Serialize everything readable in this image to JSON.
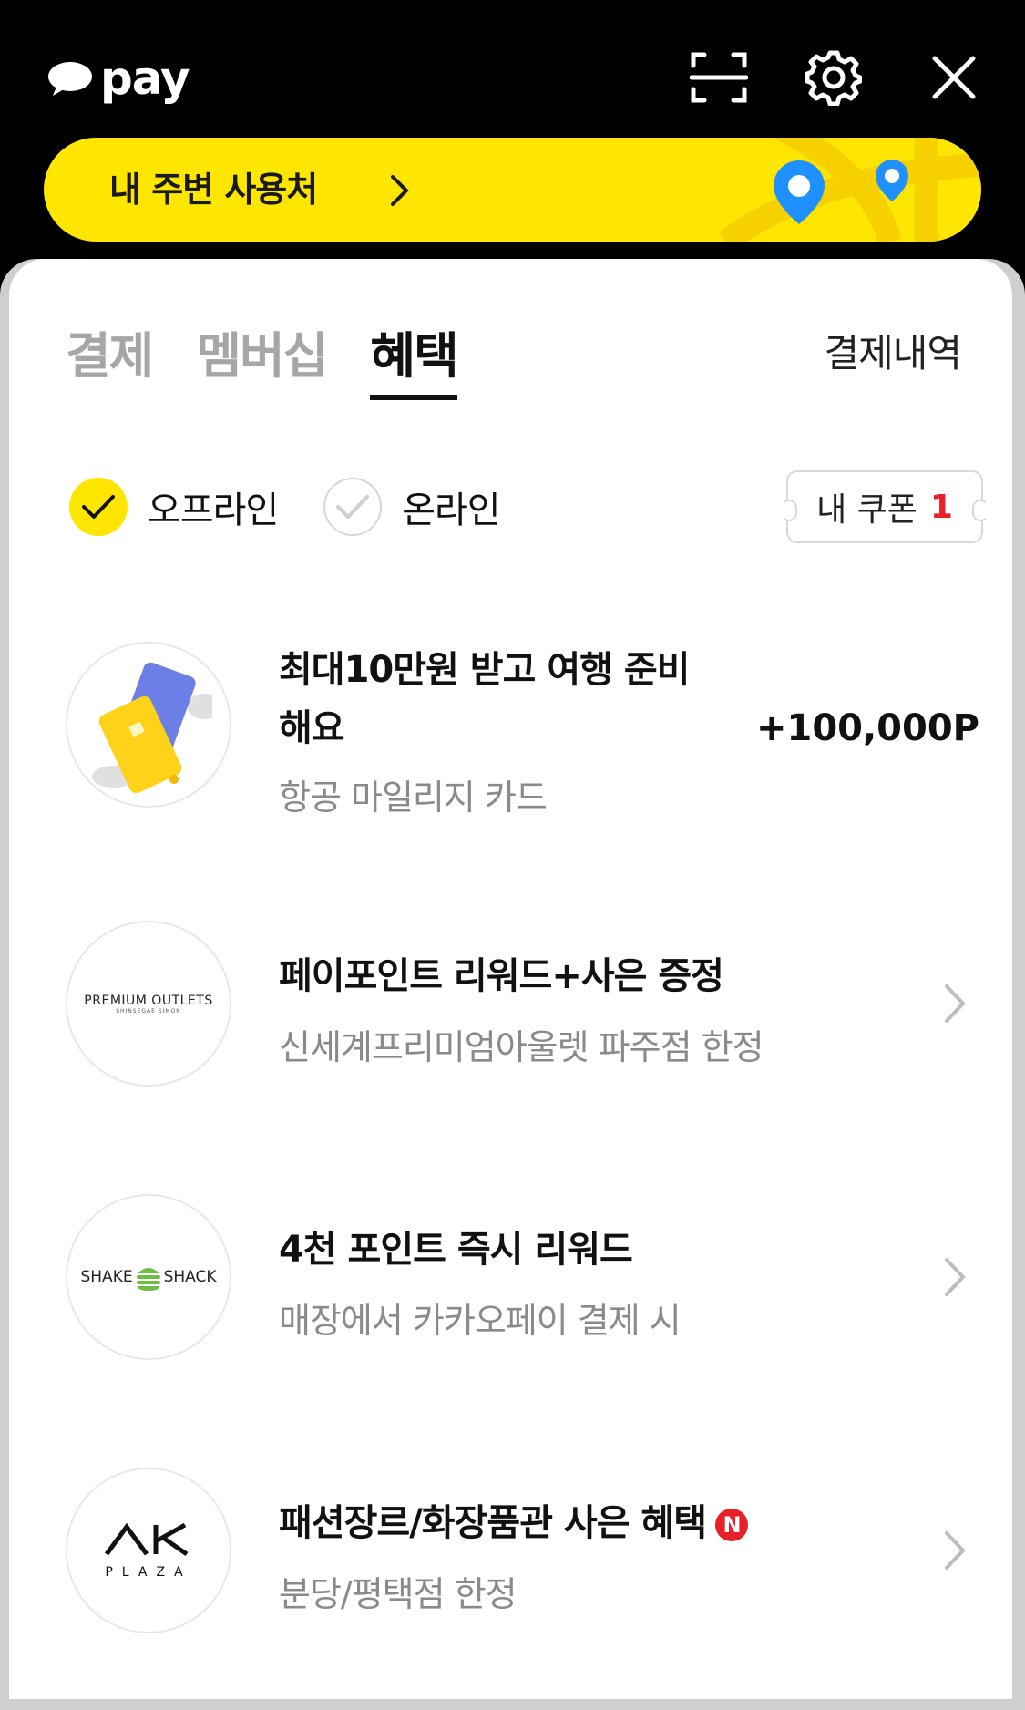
{
  "header": {
    "logo_text": "pay",
    "icons": [
      "scan-icon",
      "gear-icon",
      "close-icon"
    ]
  },
  "nearby": {
    "label": "내 주변 사용처"
  },
  "tabs": [
    {
      "label": "결제",
      "active": false
    },
    {
      "label": "멤버십",
      "active": false
    },
    {
      "label": "혜택",
      "active": true
    }
  ],
  "history_label": "결제내역",
  "filters": [
    {
      "label": "오프라인",
      "checked": true
    },
    {
      "label": "온라인",
      "checked": false
    }
  ],
  "coupon": {
    "label": "내 쿠폰",
    "count": "1"
  },
  "benefits": [
    {
      "title_line1": "최대10만원 받고 여행 준비",
      "title_line2": "해요",
      "subtitle": "항공 마일리지 카드",
      "amount": "+100,000P"
    },
    {
      "title": "페이포인트 리워드+사은 증정",
      "subtitle": "신세계프리미엄아울렛 파주점 한정",
      "logo_main": "PREMIUM OUTLETS",
      "logo_sub": "SHINSEGAE SIMON"
    },
    {
      "title": "4천 포인트 즉시 리워드",
      "subtitle": "매장에서 카카오페이 결제 시",
      "logo_left": "SHAKE",
      "logo_right": "SHACK"
    },
    {
      "title": "패션장르/화장품관 사은 혜택",
      "badge": "N",
      "subtitle": "분당/평택점 한정",
      "logo_main": "AK",
      "logo_sub": "PLAZA"
    }
  ],
  "colors": {
    "brand_yellow": "#ffe600",
    "accent_red": "#e8202a",
    "pin_blue": "#1e90ff"
  }
}
